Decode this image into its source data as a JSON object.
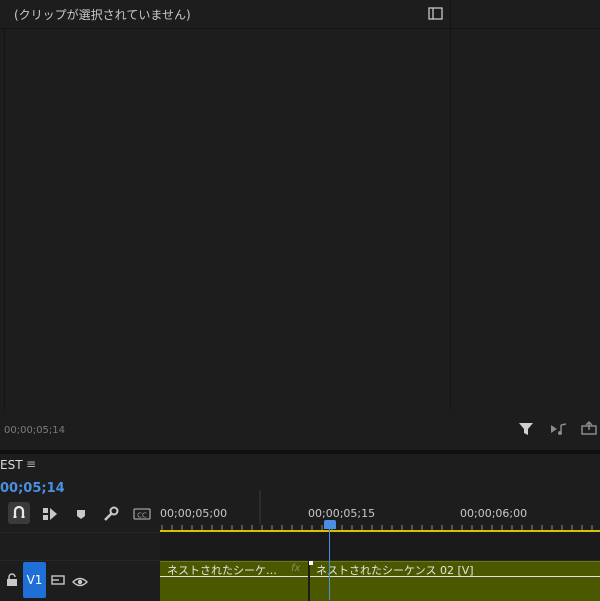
{
  "source_panel": {
    "no_clip_text": "(クリップが選択されていません)",
    "footer_timecode": "00;00;05;14",
    "icons": [
      "panel-toggle-icon",
      "filter-icon",
      "insert-icon",
      "export-icon"
    ]
  },
  "timeline": {
    "sequence_tab": "EST",
    "menu_glyph": "≡",
    "playhead_timecode": "00;05;14",
    "ruler_labels": [
      "00;00;05;00",
      "00;00;05;15",
      "00;00;06;00"
    ],
    "tools": [
      "snap-icon",
      "linked-selection-icon",
      "marker-icon",
      "wrench-icon",
      "captions-icon"
    ],
    "captions_label": "CC",
    "tracks": [
      {
        "name": "V1",
        "icons": [
          "lock-icon",
          "sync-icon",
          "eye-icon"
        ]
      }
    ],
    "clips": [
      {
        "label": "ネストされたシーケ…",
        "fx": "fx"
      },
      {
        "label": "ネストされたシーケンス 02 [V]"
      }
    ],
    "colors": {
      "accent": "#4a90e2",
      "clip": "#4c5800",
      "in_out": "#d4c200"
    }
  }
}
